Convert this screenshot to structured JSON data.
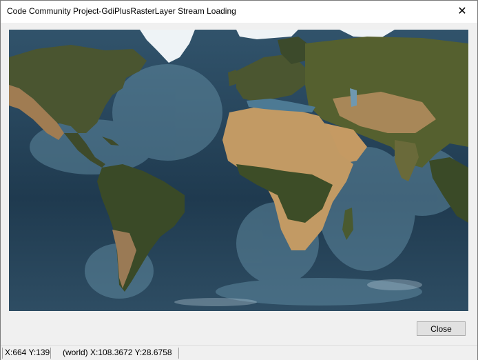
{
  "window": {
    "title": "Code Community Project-GdiPlusRasterLayer Stream Loading",
    "close_glyph": "✕"
  },
  "map": {
    "description_icon": "world-raster-map",
    "colors": {
      "ocean_deep": "#1c3447",
      "ocean_shallow": "#4a7893",
      "land_dark": "#3e4a2a",
      "land_desert": "#b08a5a",
      "ice": "#e8eef3"
    }
  },
  "buttons": {
    "close_label": "Close"
  },
  "status": {
    "screen_coords": "X:664 Y:139",
    "world_coords": "(world) X:108.3672 Y:28.6758"
  }
}
